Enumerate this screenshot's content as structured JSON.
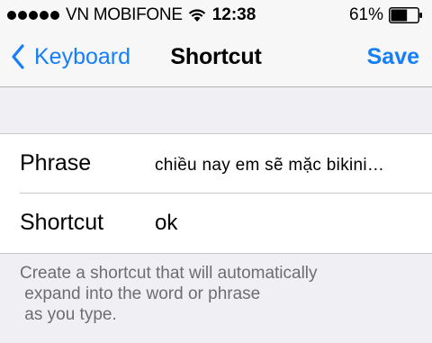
{
  "status_bar": {
    "carrier": "VN MOBIFONE",
    "time": "12:38",
    "battery_percent": "61%",
    "battery_level": 0.61,
    "signal_bars": 5,
    "icons": [
      "signal-dots-icon",
      "wifi-icon",
      "battery-icon"
    ]
  },
  "nav": {
    "back_label": "Keyboard",
    "title": "Shortcut",
    "save_label": "Save",
    "accent_color": "#157efb"
  },
  "form": {
    "rows": [
      {
        "label": "Phrase",
        "value": "chiều nay em sẽ mặc bikini…"
      },
      {
        "label": "Shortcut",
        "value": "ok"
      }
    ]
  },
  "footer": {
    "lines": [
      "Create a shortcut that will automatically",
      " expand into the word or phrase",
      " as you type."
    ]
  },
  "colors": {
    "background": "#efeff4",
    "text_secondary": "#6d6d72"
  }
}
